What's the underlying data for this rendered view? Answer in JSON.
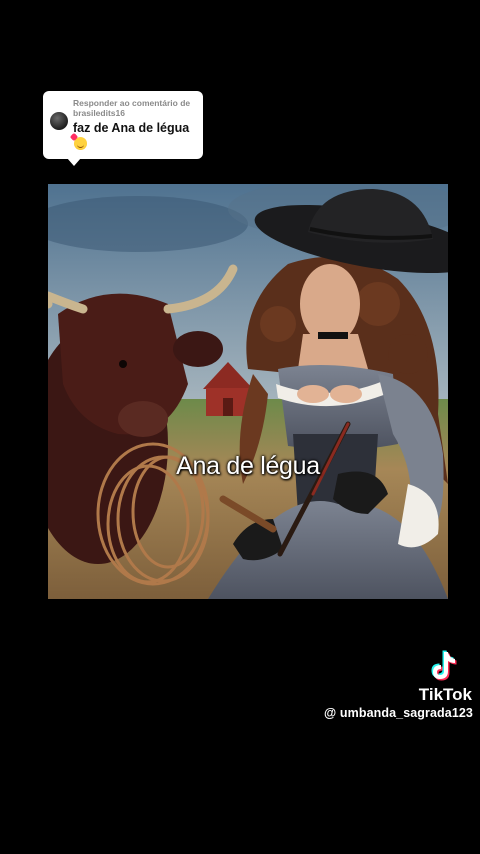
{
  "reply": {
    "header_line1": "Responder ao comentário de",
    "header_line2": "brasiledits16",
    "text": "faz de Ana de légua",
    "emoji": "smiling-face-with-hearts"
  },
  "video": {
    "caption": "Ana de légua"
  },
  "watermark": {
    "brand": "TikTok",
    "handle": "@ umbanda_sagrada123"
  },
  "colors": {
    "background": "#000000",
    "bubble": "#ffffff",
    "tiktok_cyan": "#25f4ee",
    "tiktok_red": "#fe2c55"
  }
}
